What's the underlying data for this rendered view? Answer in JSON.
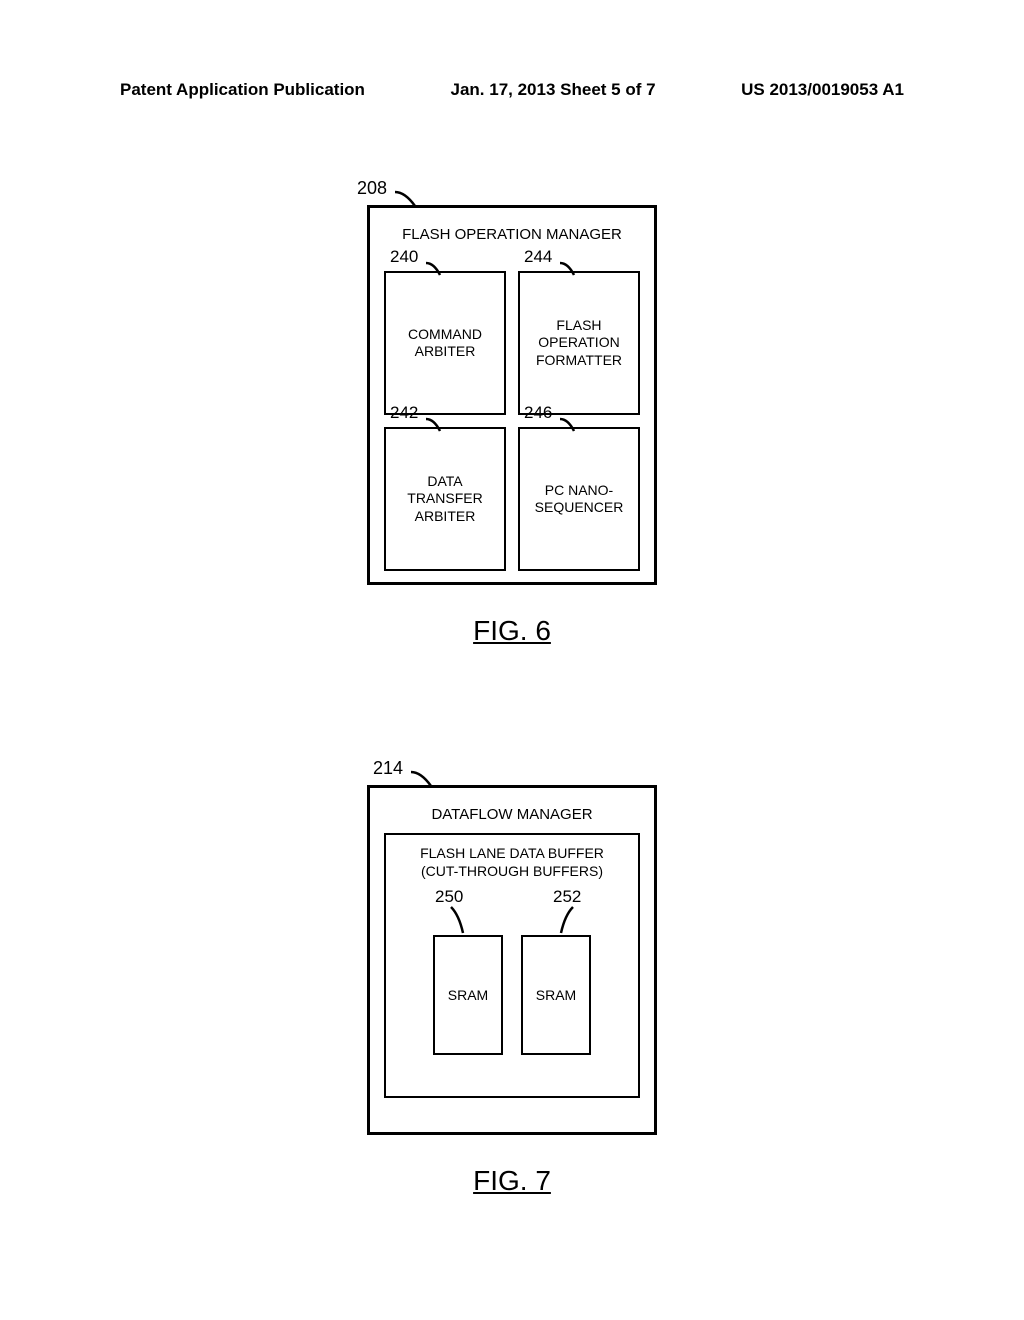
{
  "header": {
    "left": "Patent Application Publication",
    "center": "Jan. 17, 2013  Sheet 5 of 7",
    "right": "US 2013/0019053 A1"
  },
  "fig6": {
    "ref": "208",
    "title": "FLASH OPERATION MANAGER",
    "cells": {
      "topLeft": {
        "ref": "240",
        "label": "COMMAND\nARBITER"
      },
      "topRight": {
        "ref": "244",
        "label": "FLASH\nOPERATION\nFORMATTER"
      },
      "bottomLeft": {
        "ref": "242",
        "label": "DATA\nTRANSFER\nARBITER"
      },
      "bottomRight": {
        "ref": "246",
        "label": "PC NANO-\nSEQUENCER"
      }
    },
    "caption": "FIG. 6"
  },
  "fig7": {
    "ref": "214",
    "title": "DATAFLOW MANAGER",
    "bufferTitle": "FLASH LANE DATA BUFFER\n(CUT-THROUGH BUFFERS)",
    "sram": {
      "left": {
        "ref": "250",
        "label": "SRAM"
      },
      "right": {
        "ref": "252",
        "label": "SRAM"
      }
    },
    "caption": "FIG. 7"
  }
}
